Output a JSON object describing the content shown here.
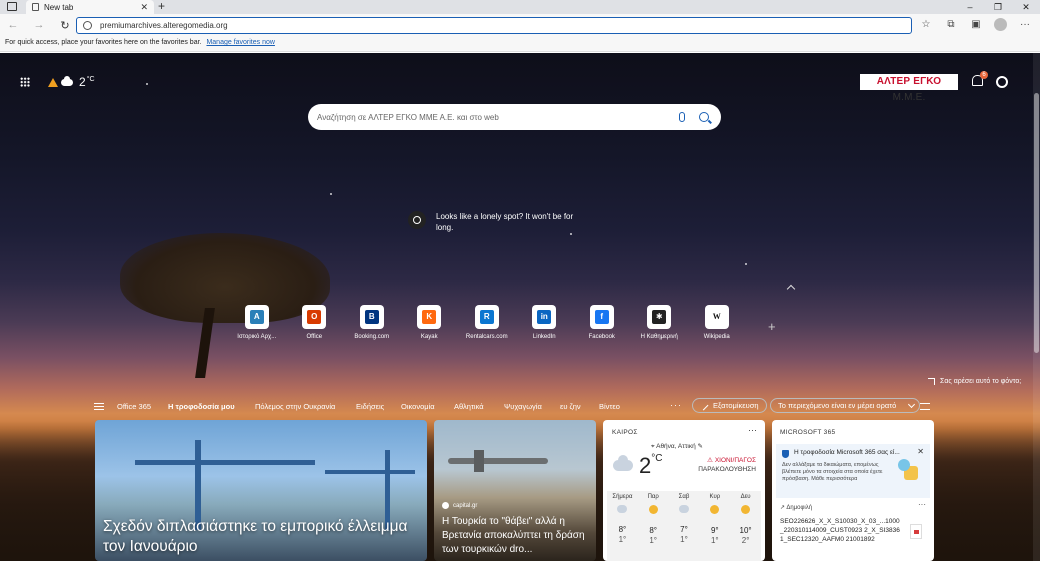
{
  "browser": {
    "tab_title": "New tab",
    "new_tab_symbol": "+",
    "url": "premiumarchives.alteregomedia.org",
    "favbar_text": "For quick access, place your favorites here on the favorites bar.",
    "favbar_link": "Manage favorites now"
  },
  "topbar": {
    "temperature": "2",
    "temp_unit": "°C",
    "brand": "ΑΛΤΕΡ ΕΓΚΟ",
    "brand_suffix": "Μ.Μ.Ε.",
    "notification_count": "6"
  },
  "search": {
    "placeholder": "Αναζήτηση σε ΑΛΤΕΡ ΕΓΚΟ ΜΜΕ Α.Ε. και στο web"
  },
  "lonely": {
    "text": "Looks like a lonely spot? It won't be for long."
  },
  "quicklinks": [
    {
      "label": "Ιστορικό Αρχ...",
      "glyph": "A",
      "color": "#2a7fb8"
    },
    {
      "label": "Office",
      "glyph": "O",
      "color": "#d83b01"
    },
    {
      "label": "Booking.com",
      "glyph": "B",
      "color": "#003580"
    },
    {
      "label": "Kayak",
      "glyph": "K",
      "color": "#ff690f"
    },
    {
      "label": "Rentalcars.com",
      "glyph": "R",
      "color": "#0b76d1"
    },
    {
      "label": "LinkedIn",
      "glyph": "in",
      "color": "#0a66c2"
    },
    {
      "label": "Facebook",
      "glyph": "f",
      "color": "#1877f2"
    },
    {
      "label": "Η Καθημερινή",
      "glyph": "✱",
      "color": "#222222"
    },
    {
      "label": "Wikipedia",
      "glyph": "W",
      "color": "#ffffff"
    }
  ],
  "background_info": "Σας αρέσει αυτό το φόντο;",
  "feednav": {
    "items": [
      "Office 365",
      "Η τροφοδοσία μου",
      "Πόλεμος στην Ουκρανία",
      "Ειδήσεις",
      "Οικονομία",
      "Αθλητικά",
      "Ψυχαγωγία",
      "ευ ζην",
      "Βίντεο"
    ],
    "active_index": 1,
    "customize": "Εξατομίκευση",
    "visibility": "Το περιεχόμενο είναι εν μέρει ορατό"
  },
  "hero": {
    "title": "Σχεδόν διπλασιάστηκε το εμπορικό έλλειμμα τον Ιανουάριο"
  },
  "news2": {
    "source": "capital.gr",
    "title": "Η Τουρκία το \"θάβει\" αλλά η Βρετανία αποκαλύπτει τη δράση των τουρκικών dro..."
  },
  "weather": {
    "header": "ΚΑΙΡΟΣ",
    "location": "Αθήνα, Αττική",
    "temp": "2",
    "unit": "°C",
    "alert_line1": "ΧΙΟΝΙ/ΠΑΓΟΣ",
    "alert_line2": "ΠΑΡΑΚΟΛΟΥΘΗΣΗ",
    "days": [
      {
        "name": "Σήμερα",
        "hi": "8°",
        "lo": "1°",
        "icon": "cloud"
      },
      {
        "name": "Παρ",
        "hi": "8°",
        "lo": "1°",
        "icon": "sun"
      },
      {
        "name": "Σαβ",
        "hi": "7°",
        "lo": "1°",
        "icon": "cloud"
      },
      {
        "name": "Κυρ",
        "hi": "9°",
        "lo": "1°",
        "icon": "sun"
      },
      {
        "name": "Δευ",
        "hi": "10°",
        "lo": "2°",
        "icon": "sun"
      }
    ]
  },
  "ms365": {
    "header": "MICROSOFT 365",
    "notice_title": "Η τροφοδοσία Microsoft 365 σας εί...",
    "notice_body": "Δεν αλλάξαμε τα δικαιώματα, επομένως βλέπετε μόνο τα στοιχεία στα οποία έχετε πρόσβαση. Μάθε περισσότερα",
    "trending": "Δημοφιλή",
    "file_name": "SEO226626_X_X_S10030_X_03_...1000_220310114009_CUST0923 2_X_SI38361_SEC12320_AAFM0 21001892"
  }
}
